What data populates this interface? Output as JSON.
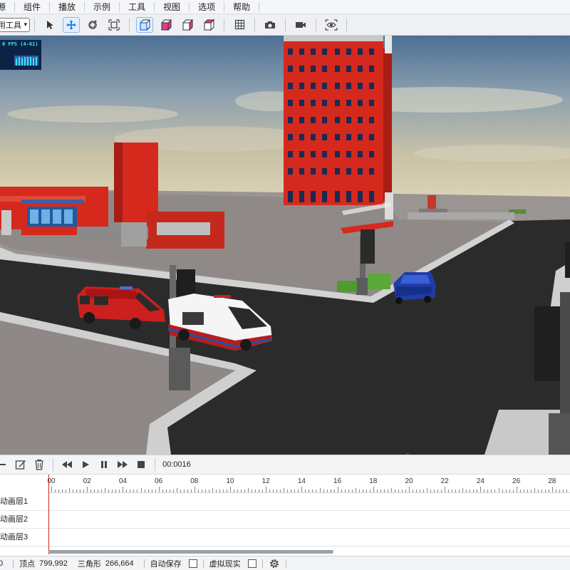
{
  "menu": {
    "items": [
      "源",
      "组件",
      "播放",
      "示例",
      "工具",
      "视图",
      "选项",
      "帮助"
    ]
  },
  "toolbar": {
    "tool_select_value": "用工具",
    "tools": [
      {
        "name": "select-tool-button",
        "icon": "pointer-icon",
        "active": false
      },
      {
        "name": "move-tool-button",
        "icon": "move-icon",
        "active": true
      },
      {
        "name": "rotate-tool-button",
        "icon": "rotate-icon",
        "active": false
      },
      {
        "name": "scale-tool-button",
        "icon": "scale-icon",
        "active": false
      },
      {
        "name": "view-cube-front-button",
        "icon": "cube-front-icon",
        "active": true
      },
      {
        "name": "view-cube-pink-button",
        "icon": "cube-pink-icon",
        "active": false
      },
      {
        "name": "view-cube-side-button",
        "icon": "cube-side-icon",
        "active": false
      },
      {
        "name": "view-cube-top-button",
        "icon": "cube-top-icon",
        "active": false
      },
      {
        "name": "grid-button",
        "icon": "grid-icon",
        "active": false
      },
      {
        "name": "screenshot-button",
        "icon": "camera-icon",
        "active": false
      },
      {
        "name": "record-button",
        "icon": "video-camera-icon",
        "active": false
      },
      {
        "name": "preview-button",
        "icon": "eye-icon",
        "active": false
      }
    ]
  },
  "viewport": {
    "fps_text": "0 FPS (4-61)"
  },
  "timeline_toolbar": {
    "time": "00:0016"
  },
  "timeline": {
    "ruler_labels": [
      "00",
      "02",
      "04",
      "06",
      "08",
      "10",
      "12",
      "14",
      "16",
      "18",
      "20",
      "22",
      "24",
      "26",
      "28"
    ],
    "layers": [
      "动画层1",
      "动画层2",
      "动画层3"
    ]
  },
  "status": {
    "first_value": "0",
    "vertices_label": "顶点",
    "vertices_value": "799,992",
    "triangles_label": "三角形",
    "triangles_value": "266,664",
    "autosave_label": "自动保存",
    "vr_label": "虚拟现实"
  },
  "colors": {
    "accent": "#2d7fe6",
    "playhead": "#e02020",
    "building_red": "#d6291d",
    "road": "#2b2b2b"
  }
}
